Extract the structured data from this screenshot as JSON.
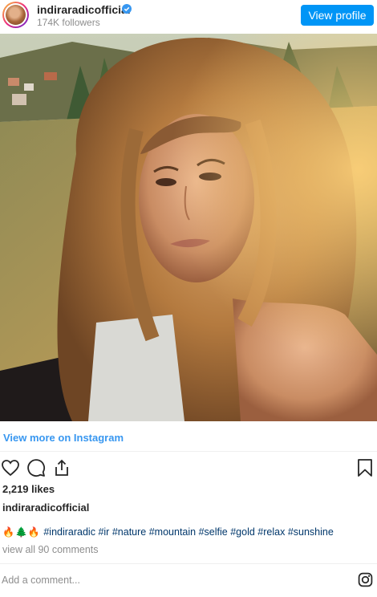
{
  "header": {
    "username": "indiraradicofficial",
    "followers": "174K followers",
    "view_profile": "View profile"
  },
  "photo": {
    "alt": "Selfie of a woman with long wavy golden-brown hair in sunset light outdoors on a mountain"
  },
  "view_more": "View more on Instagram",
  "actions": {
    "icons": [
      "heart-icon",
      "comment-icon",
      "share-icon",
      "bookmark-icon"
    ]
  },
  "likes": "2,219 likes",
  "caption": {
    "username": "indiraradicofficial",
    "emojis": [
      "🔥",
      "🌲",
      "🔥"
    ],
    "hashtags": [
      "#indiraradic",
      "#ir",
      "#nature",
      "#mountain",
      "#selfie",
      "#gold",
      "#relax",
      "#sunshine"
    ]
  },
  "view_comments": "view all 90 comments",
  "comment": {
    "placeholder": "Add a comment..."
  },
  "colors": {
    "accent": "#0095f6",
    "link": "#3897f0",
    "hashtag": "#00376b",
    "muted": "#8e8e8e"
  }
}
